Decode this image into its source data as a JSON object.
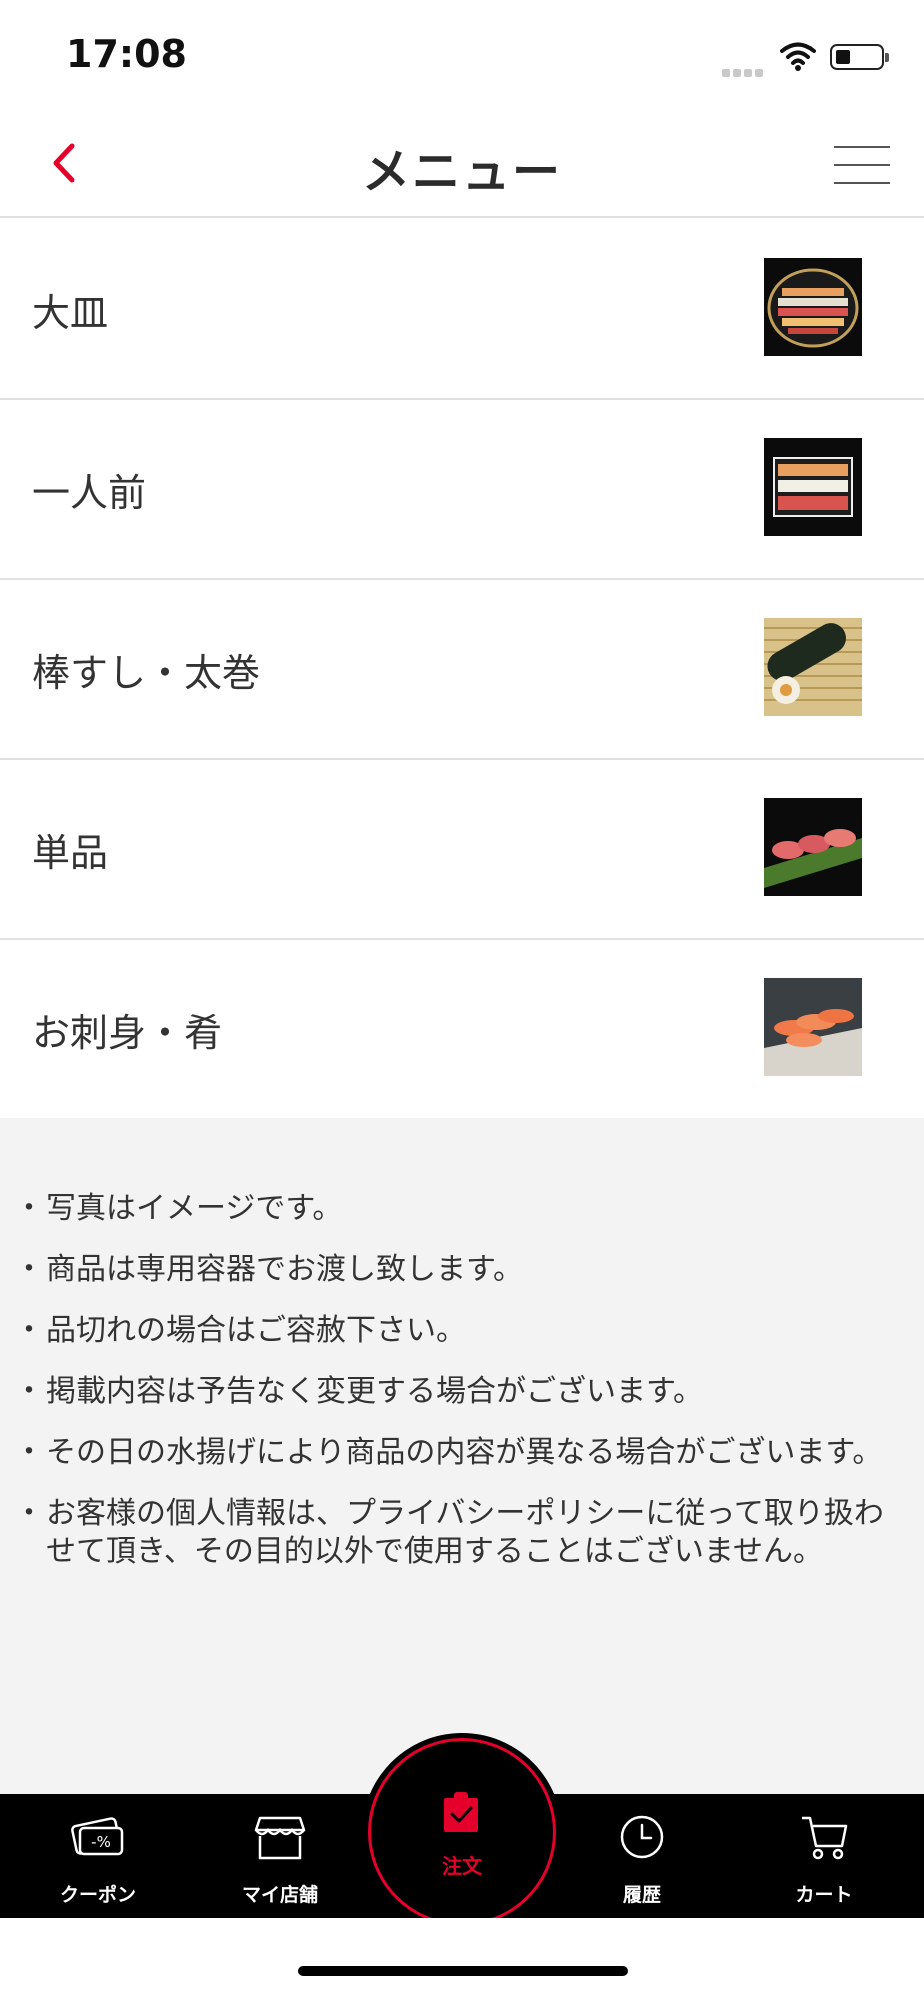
{
  "status_bar": {
    "time": "17:08"
  },
  "header": {
    "title": "メニュー"
  },
  "menu": [
    {
      "label": "大皿",
      "image": "platter-image"
    },
    {
      "label": "一人前",
      "image": "single-serving-image"
    },
    {
      "label": "棒すし・太巻",
      "image": "roll-image"
    },
    {
      "label": "単品",
      "image": "nigiri-image"
    },
    {
      "label": "お刺身・肴",
      "image": "sashimi-image"
    }
  ],
  "notes": [
    "写真はイメージです。",
    "商品は専用容器でお渡し致します。",
    "品切れの場合はご容赦下さい。",
    "掲載内容は予告なく変更する場合がございます。",
    "その日の水揚げにより商品の内容が異なる場合がございます。",
    "お客様の個人情報は、プライバシーポリシーに従って取り扱わせて頂き、その目的以外で使用することはございません。"
  ],
  "tabbar": {
    "coupon": "クーポン",
    "my_store": "マイ店舗",
    "order": "注文",
    "history": "履歴",
    "cart": "カート"
  },
  "colors": {
    "accent": "#e4002b",
    "tabbar_bg": "#000000",
    "notes_bg": "#f3f3f3"
  }
}
